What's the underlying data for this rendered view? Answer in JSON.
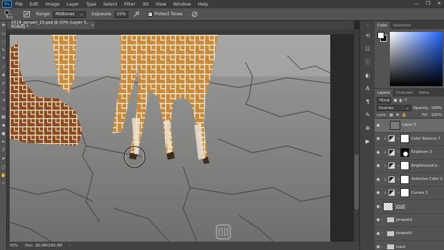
{
  "menubar": {
    "logo": "Ps",
    "items": [
      "File",
      "Edit",
      "Image",
      "Layer",
      "Type",
      "Select",
      "Filter",
      "3D",
      "View",
      "Window",
      "Help"
    ],
    "window_controls": [
      "—",
      "❐",
      "✕"
    ]
  },
  "options": {
    "brush_size": "175",
    "range_label": "Range:",
    "range_value": "Midtones",
    "exposure_label": "Exposure:",
    "exposure_value": "15%",
    "protect_tones_label": "Protect Tones",
    "protect_tones_checked": true
  },
  "document": {
    "tab_title": "2018_januari_10.psd @ 50% (Layer 5, RGB/8) *",
    "close_glyph": "×"
  },
  "status": {
    "zoom": "50%",
    "doc_size": "Doc: 28,0M/280,3M"
  },
  "color_panel": {
    "tabs": [
      "Color",
      "Swatches"
    ],
    "foreground": "#ffffff",
    "background": "#0e0e0e"
  },
  "layers_panel": {
    "tabs": [
      "Layers",
      "Channels",
      "Paths"
    ],
    "filter_kind": "Kind",
    "blend_mode": "Overlay",
    "opacity_label": "Opacity:",
    "opacity_value": "100%",
    "lock_label": "Lock:",
    "fill_label": "Fill:",
    "fill_value": "100%",
    "layers": [
      {
        "name": "Layer 5",
        "type": "pixel",
        "selected": true
      },
      {
        "name": "Color Balance 7",
        "type": "adjustment"
      },
      {
        "name": "Exposure 3",
        "type": "adjustment-dark-mask"
      },
      {
        "name": "Brightness/Co...",
        "type": "adjustment"
      },
      {
        "name": "Selective Color 2",
        "type": "adjustment"
      },
      {
        "name": "Curves 3",
        "type": "adjustment"
      },
      {
        "name": "small",
        "type": "pixel-checker"
      },
      {
        "name": "jerapah2",
        "type": "group"
      },
      {
        "name": "jerapah1",
        "type": "group"
      },
      {
        "name": "track",
        "type": "group"
      }
    ]
  }
}
